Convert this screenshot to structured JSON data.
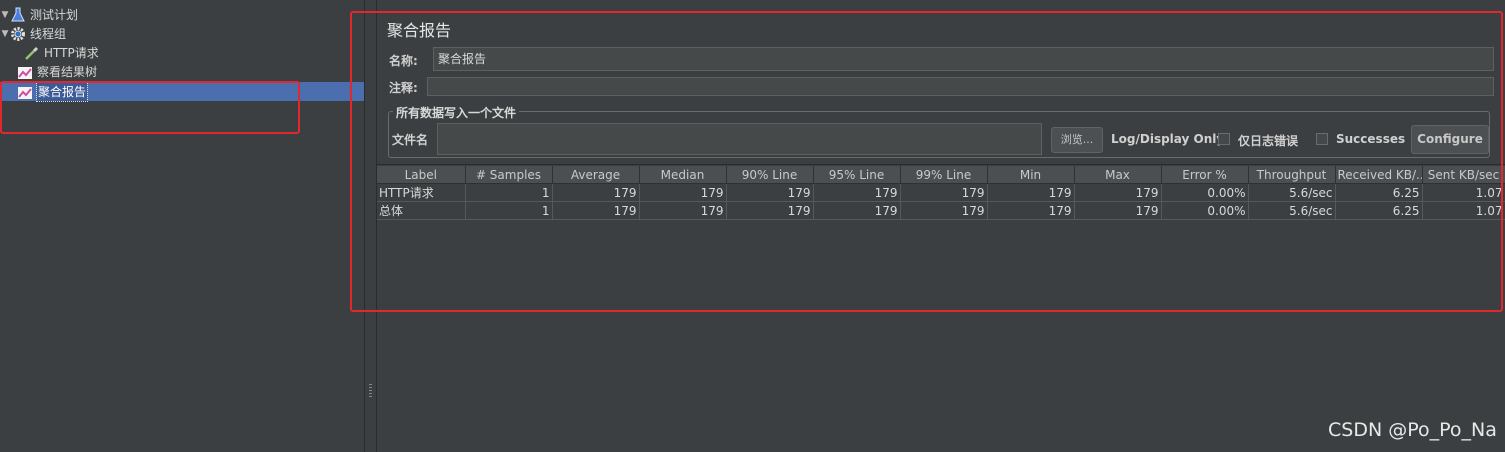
{
  "tree": {
    "items": [
      {
        "label": "测试计划",
        "icon": "flask-icon"
      },
      {
        "label": "线程组",
        "icon": "gear-icon"
      },
      {
        "label": "HTTP请求",
        "icon": "pipette-icon"
      },
      {
        "label": "察看结果树",
        "icon": "chart-icon"
      },
      {
        "label": "聚合报告",
        "icon": "chart-icon"
      }
    ]
  },
  "panel": {
    "title": "聚合报告",
    "name_label": "名称:",
    "name_value": "聚合报告",
    "comment_label": "注释:",
    "comment_value": "",
    "file_group_label": "所有数据写入一个文件",
    "file_label": "文件名",
    "file_value": "",
    "browse_label": "浏览...",
    "log_only_label": "Log/Display Only:",
    "errors_label": "仅日志错误",
    "successes_label": "Successes",
    "configure_label": "Configure"
  },
  "table": {
    "headers": [
      "Label",
      "# Samples",
      "Average",
      "Median",
      "90% Line",
      "95% Line",
      "99% Line",
      "Min",
      "Max",
      "Error %",
      "Throughput",
      "Received KB/...",
      "Sent KB/sec"
    ],
    "rows": [
      [
        "HTTP请求",
        "1",
        "179",
        "179",
        "179",
        "179",
        "179",
        "179",
        "179",
        "0.00%",
        "5.6/sec",
        "6.25",
        "1.07"
      ],
      [
        "总体",
        "1",
        "179",
        "179",
        "179",
        "179",
        "179",
        "179",
        "179",
        "0.00%",
        "5.6/sec",
        "6.25",
        "1.07"
      ]
    ]
  },
  "watermark": "CSDN @Po_Po_Na",
  "colors": {
    "background": "#3c3f41",
    "selection": "#4b6eaf",
    "highlight_box": "#e0282e"
  }
}
